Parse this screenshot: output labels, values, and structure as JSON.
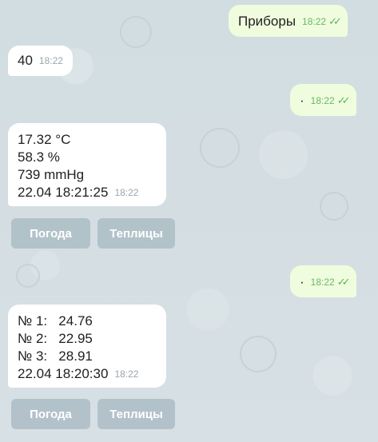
{
  "messages": [
    {
      "type": "out",
      "text": "Приборы",
      "time": "18:22"
    },
    {
      "type": "in",
      "text": "40",
      "time": "18:22"
    },
    {
      "type": "out",
      "text": "·",
      "time": "18:22"
    },
    {
      "type": "in",
      "lines": [
        "17.32 °C",
        "58.3 %",
        "739 mmHg",
        "22.04 18:21:25"
      ],
      "time": "18:22"
    },
    {
      "type": "out",
      "text": "·",
      "time": "18:22"
    },
    {
      "type": "in",
      "lines": [
        "№ 1:   24.76",
        "№ 2:   22.95",
        "№ 3:   28.91",
        "22.04 18:20:30"
      ],
      "time": "18:22"
    }
  ],
  "keyboard": {
    "btn1": "Погода",
    "btn2": "Теплицы"
  },
  "colors": {
    "outgoing_bubble": "#effdde",
    "incoming_bubble": "#ffffff",
    "check_color": "#5fb35a"
  }
}
